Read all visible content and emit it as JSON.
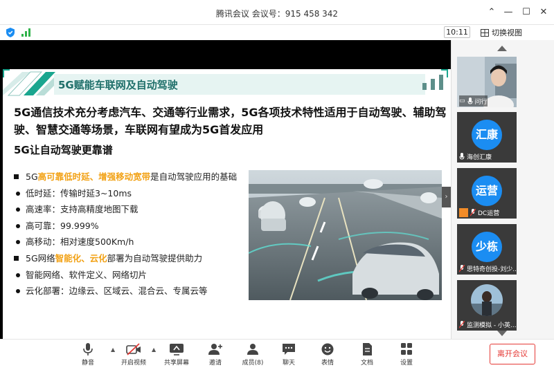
{
  "window": {
    "title": "腾讯会议 会议号：915 458 342"
  },
  "infobar": {
    "time": "10:11",
    "switch_view": "切换视图"
  },
  "slide": {
    "title": "5G赋能车联网及自动驾驶",
    "main_text": "5G通信技术充分考虑汽车、交通等行业需求，5G各项技术特性适用于自动驾驶、辅助驾驶、智慧交通等场景，车联网有望成为5G首发应用",
    "sub_text": "5G让自动驾驶更靠谱",
    "bullet1": {
      "prefix": "5G",
      "highlight": "高可靠低时延、增强移动宽带",
      "suffix": "是自动驾驶应用的基础"
    },
    "sub1": [
      "低时延：传输时延3~10ms",
      "高速率：支持高精度地图下载",
      "高可靠：99.999%",
      "高移动：相对速度500Km/h"
    ],
    "bullet2": {
      "prefix": "5G网络",
      "highlight": "智能化、云化",
      "suffix": "部署为自动驾驶提供助力"
    },
    "sub2": [
      "智能网络、软件定义、网络切片",
      "云化部署：边缘云、区域云、混合云、专属云等"
    ]
  },
  "participants": [
    {
      "name": "问行",
      "type": "video"
    },
    {
      "name": "海创汇康",
      "avatar": "汇康"
    },
    {
      "name": "DC运营",
      "avatar": "运营"
    },
    {
      "name": "思特奇创投-刘少...",
      "avatar": "少栋"
    },
    {
      "name": "监测模拟 - 小英...",
      "type": "photo"
    }
  ],
  "toolbar": {
    "mute": "静音",
    "video": "开启视频",
    "share": "共享屏幕",
    "invite": "邀请",
    "members": "成员(8)",
    "chat": "聊天",
    "reactions": "表情",
    "docs": "文档",
    "settings": "设置",
    "leave": "离开会议"
  },
  "colors": {
    "accent": "#1b8df2",
    "highlight": "#f2a114",
    "danger": "#e53935",
    "teal": "#1f6f6a"
  }
}
